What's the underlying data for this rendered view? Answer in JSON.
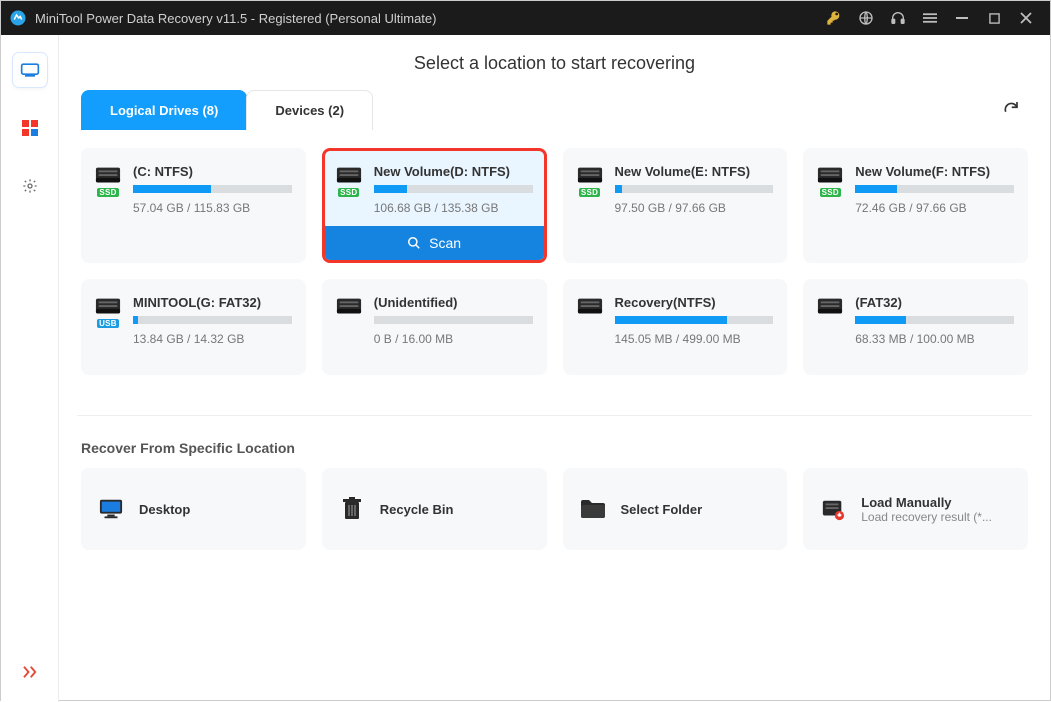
{
  "window": {
    "title": "MiniTool Power Data Recovery v11.5 - Registered (Personal Ultimate)"
  },
  "heading": "Select a location to start recovering",
  "tabs": {
    "logical": "Logical Drives (8)",
    "devices": "Devices (2)"
  },
  "drives": [
    {
      "name": "(C: NTFS)",
      "size": "57.04 GB / 115.83 GB",
      "fillPct": 49,
      "badge": "SSD",
      "selected": false
    },
    {
      "name": "New Volume(D: NTFS)",
      "size": "106.68 GB / 135.38 GB",
      "fillPct": 21,
      "badge": "SSD",
      "selected": true
    },
    {
      "name": "New Volume(E: NTFS)",
      "size": "97.50 GB / 97.66 GB",
      "fillPct": 5,
      "badge": "SSD",
      "selected": false
    },
    {
      "name": "New Volume(F: NTFS)",
      "size": "72.46 GB / 97.66 GB",
      "fillPct": 26,
      "badge": "SSD",
      "selected": false
    },
    {
      "name": "MINITOOL(G: FAT32)",
      "size": "13.84 GB / 14.32 GB",
      "fillPct": 3,
      "badge": "USB",
      "selected": false
    },
    {
      "name": "(Unidentified)",
      "size": "0 B / 16.00 MB",
      "fillPct": 0,
      "badge": "",
      "selected": false
    },
    {
      "name": "Recovery(NTFS)",
      "size": "145.05 MB / 499.00 MB",
      "fillPct": 71,
      "badge": "",
      "selected": false
    },
    {
      "name": "(FAT32)",
      "size": "68.33 MB / 100.00 MB",
      "fillPct": 32,
      "badge": "",
      "selected": false
    }
  ],
  "scan_label": "Scan",
  "section_title": "Recover From Specific Location",
  "locations": [
    {
      "label": "Desktop",
      "sub": "",
      "icon": "desktop"
    },
    {
      "label": "Recycle Bin",
      "sub": "",
      "icon": "trash"
    },
    {
      "label": "Select Folder",
      "sub": "",
      "icon": "folder"
    },
    {
      "label": "Load Manually",
      "sub": "Load recovery result (*...",
      "icon": "load"
    }
  ]
}
